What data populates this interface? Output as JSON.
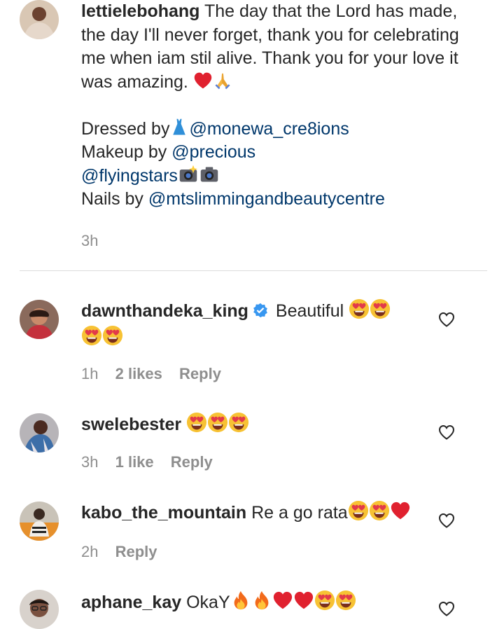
{
  "caption": {
    "username": "lettielebohang",
    "text_1": "The day that the Lord has made, the day I'll never forget, thank you for celebrating me when iam stil alive. Thank you for your love it was amazing.",
    "dressed_prefix": "Dressed by",
    "dressed_mention": "@monewa_cre8ions",
    "makeup_prefix": "Makeup by ",
    "makeup_mention": "@precious",
    "photo_mention": "@flyingstars",
    "nails_prefix": "Nails by ",
    "nails_mention": "@mtslimmingandbeautycentre",
    "time": "3h"
  },
  "comments": [
    {
      "username": "dawnthandeka_king",
      "text": "Beautiful",
      "time": "1h",
      "likes": "2 likes",
      "reply": "Reply"
    },
    {
      "username": "swelebester",
      "text": "",
      "time": "3h",
      "likes": "1 like",
      "reply": "Reply"
    },
    {
      "username": "kabo_the_mountain",
      "text": "Re a go rata",
      "time": "2h",
      "reply": "Reply"
    },
    {
      "username": "aphane_kay",
      "text": "OkaY"
    }
  ],
  "icons": {
    "like": "heart-outline-icon",
    "verified": "verified-badge-icon",
    "emoji": [
      "heart-eyes-emoji",
      "red-heart-emoji",
      "folded-hands-emoji",
      "fire-emoji",
      "dress-emoji",
      "camera-flash-emoji",
      "camera-emoji"
    ]
  },
  "colors": {
    "mention": "#00376b",
    "secondary": "#8e8e8e",
    "verified": "#3897f0"
  }
}
